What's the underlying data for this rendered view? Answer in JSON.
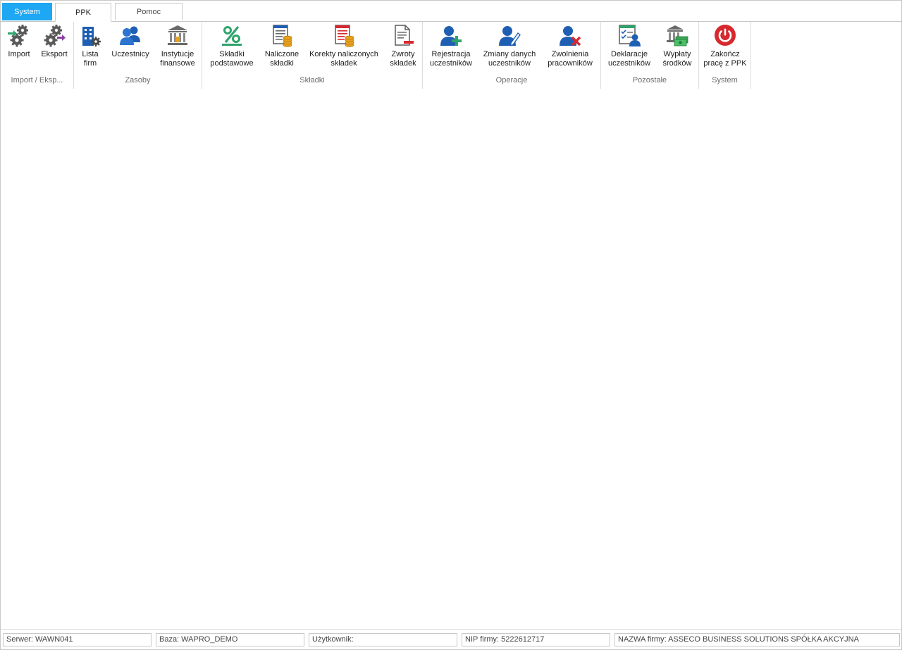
{
  "tabs": [
    "System",
    "PPK",
    "Pomoc"
  ],
  "ribbon": {
    "import_export": {
      "label": "Import / Eksp...",
      "import": [
        "Import"
      ],
      "export": [
        "Eksport"
      ]
    },
    "zasoby": {
      "label": "Zasoby",
      "lista_firm": [
        "Lista",
        "firm"
      ],
      "uczestnicy": [
        "Uczestnicy"
      ],
      "instytucje": [
        "Instytucje",
        "finansowe"
      ]
    },
    "skladki": {
      "label": "Składki",
      "podstawowe": [
        "Składki",
        "podstawowe"
      ],
      "naliczone": [
        "Naliczone",
        "składki"
      ],
      "korekty": [
        "Korekty naliczonych",
        "składek"
      ],
      "zwroty": [
        "Zwroty",
        "składek"
      ]
    },
    "operacje": {
      "label": "Operacje",
      "rejestracja": [
        "Rejestracja",
        "uczestników"
      ],
      "zmiany": [
        "Zmiany danych",
        "uczestników"
      ],
      "zwolnienia": [
        "Zwolnienia",
        "pracowników"
      ]
    },
    "pozostale": {
      "label": "Pozostałe",
      "deklaracje": [
        "Deklaracje",
        "uczestników"
      ],
      "wyplaty": [
        "Wypłaty",
        "środków"
      ]
    },
    "system": {
      "label": "System",
      "zakoncz": [
        "Zakończ",
        "pracę z PPK"
      ]
    }
  },
  "status": {
    "server": "Serwer: WAWN041",
    "database": "Baza: WAPRO_DEMO",
    "user": "Użytkownik:",
    "nip": "NIP firmy: 5222612717",
    "company": "NAZWA firmy: ASSECO BUSINESS SOLUTIONS SPÓŁKA AKCYJNA"
  },
  "colors": {
    "accent_tab": "#1ea7f2",
    "icon_blue": "#1f5fb3",
    "icon_green": "#2ea36b",
    "icon_red": "#d7282e",
    "icon_purple": "#8a3fa0",
    "gear_gray": "#5a5a5a"
  },
  "icons": [
    "gears-import-icon",
    "gears-export-icon",
    "building-gear-icon",
    "users-icon",
    "bank-icon",
    "percent-icon",
    "document-coins-icon",
    "document-coins-red-icon",
    "document-minus-icon",
    "user-add-icon",
    "user-edit-icon",
    "user-remove-icon",
    "checklist-user-icon",
    "bank-money-icon",
    "power-icon"
  ]
}
